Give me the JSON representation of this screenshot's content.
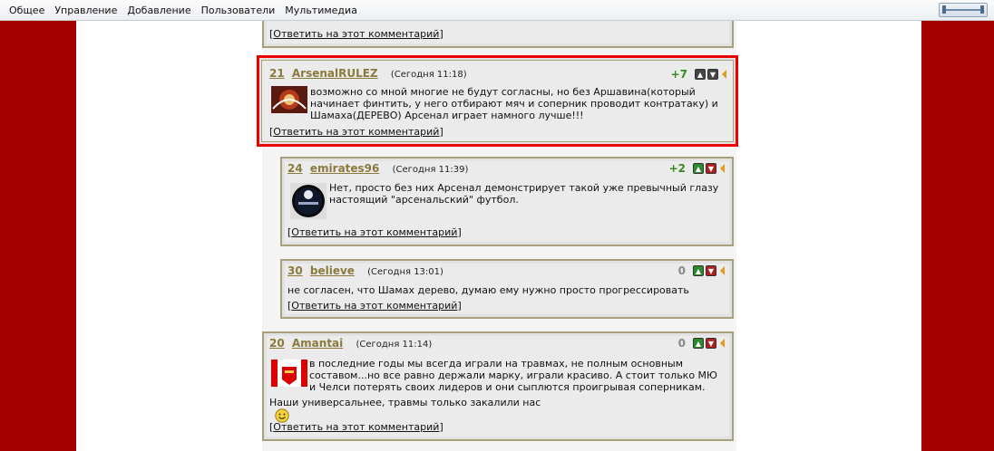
{
  "menu": [
    "Общее",
    "Управление",
    "Добавление",
    "Пользователи",
    "Мультимедиа"
  ],
  "reply_label": "Ответить на этот комментарий",
  "comments": [
    {
      "num": "21",
      "author": "ArsenalRULEZ",
      "time": "(Сегодня 11:18)",
      "score": "+7",
      "text": "возможно со мной многие не будут согласны, но без Аршавина(который начинает финтить, у него отбирают мяч и соперник проводит контратаку) и Шамаха(ДЕРЕВО) Арсенал играет намного лучше!!!"
    },
    {
      "num": "24",
      "author": "emirates96",
      "time": "(Сегодня 11:39)",
      "score": "+2",
      "text": "Нет, просто без них Арсенал демонстрирует такой уже превычный глазу настоящий \"арсенальский\" футбол."
    },
    {
      "num": "30",
      "author": "believe",
      "time": "(Сегодня 13:01)",
      "score": "0",
      "text": "не согласен, что Шамах дерево, думаю ему нужно просто прогрессировать"
    },
    {
      "num": "20",
      "author": "Amantai",
      "time": "(Сегодня 11:14)",
      "score": "0",
      "text": "в последние годы мы всегда играли на травмах, не полным основным составом...но все равно держали марку, играли красиво. А стоит только МЮ и Челси потерять своих лидеров и они сыплются проигрывая соперникам.",
      "extra": "Наши универсальнее, травмы только закалили нас"
    }
  ],
  "colors": {
    "band": "#a50000",
    "highlight": "#ee0000",
    "username": "#8a7a3c",
    "positive": "#3a8a1e"
  }
}
